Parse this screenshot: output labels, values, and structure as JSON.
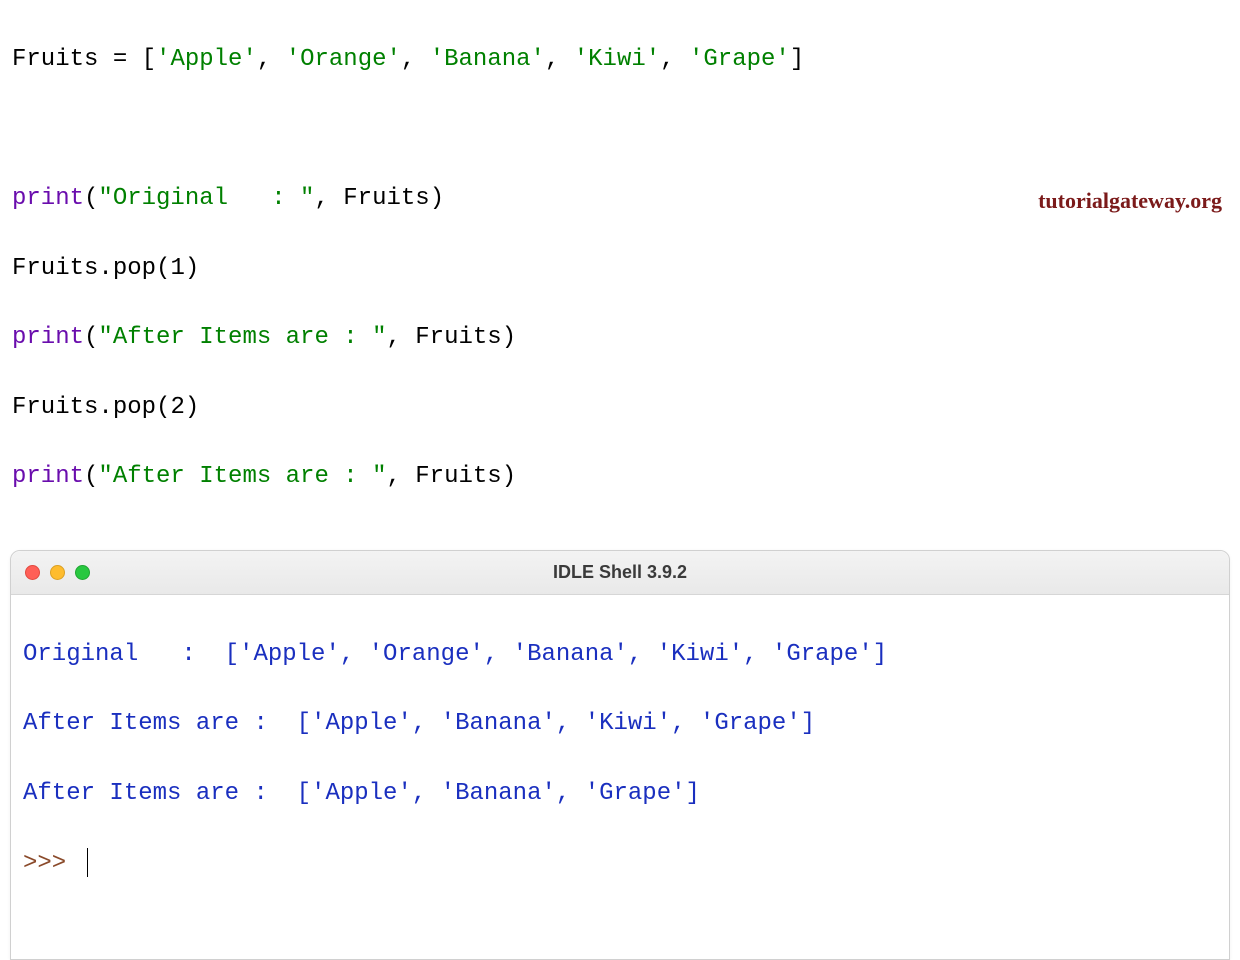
{
  "editor": {
    "l1": {
      "var": "Fruits",
      "eq": " = ",
      "lb": "[",
      "s1": "'Apple'",
      "c1": ", ",
      "s2": "'Orange'",
      "c2": ", ",
      "s3": "'Banana'",
      "c3": ", ",
      "s4": "'Kiwi'",
      "c4": ", ",
      "s5": "'Grape'",
      "rb": "]"
    },
    "l3": {
      "fn": "print",
      "lp": "(",
      "str": "\"Original   : \"",
      "cm": ", ",
      "arg": "Fruits",
      "rp": ")"
    },
    "l4": {
      "obj": "Fruits",
      "dot": ".",
      "m": "pop",
      "lp": "(",
      "n": "1",
      "rp": ")"
    },
    "l5": {
      "fn": "print",
      "lp": "(",
      "str": "\"After Items are : \"",
      "cm": ", ",
      "arg": "Fruits",
      "rp": ")"
    },
    "l6": {
      "obj": "Fruits",
      "dot": ".",
      "m": "pop",
      "lp": "(",
      "n": "2",
      "rp": ")"
    },
    "l7": {
      "fn": "print",
      "lp": "(",
      "str": "\"After Items are : \"",
      "cm": ", ",
      "arg": "Fruits",
      "rp": ")"
    }
  },
  "watermark": "tutorialgateway.org",
  "shell": {
    "title": "IDLE Shell 3.9.2",
    "out1": "Original   :  ['Apple', 'Orange', 'Banana', 'Kiwi', 'Grape']",
    "out2": "After Items are :  ['Apple', 'Banana', 'Kiwi', 'Grape']",
    "out3": "After Items are :  ['Apple', 'Banana', 'Grape']",
    "prompt": ">>> "
  }
}
